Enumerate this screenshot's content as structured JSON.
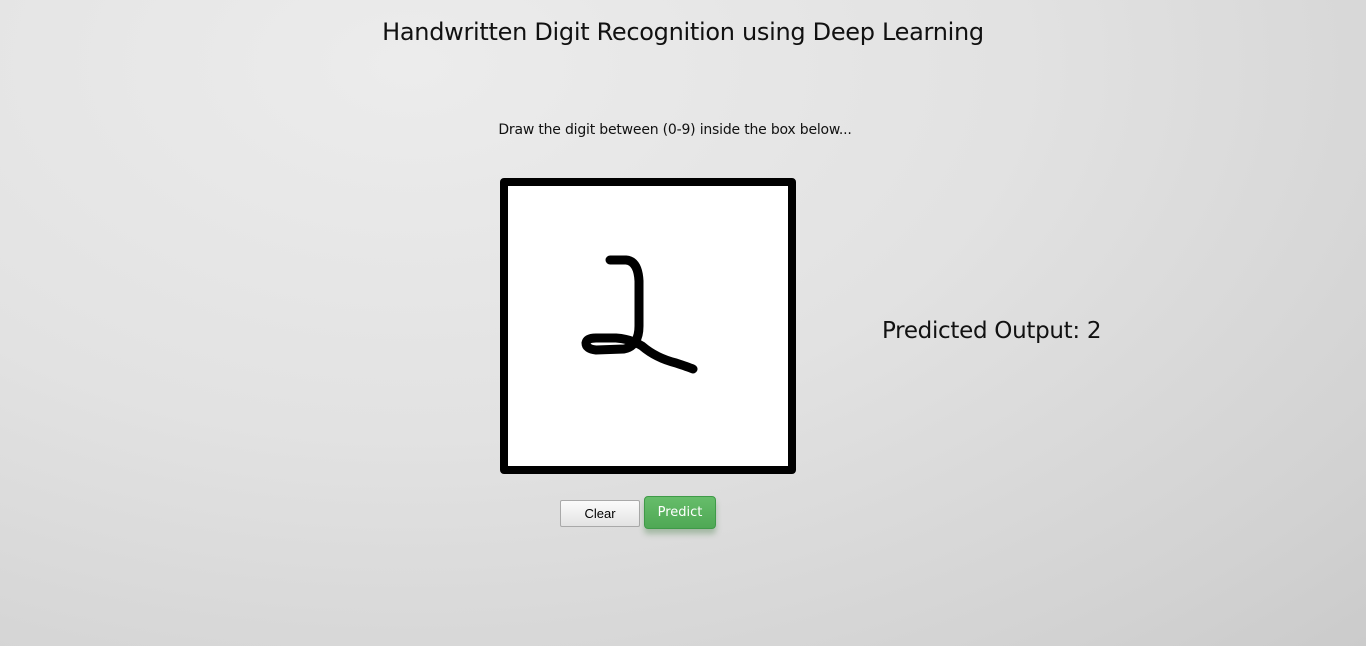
{
  "header": {
    "title": "Handwritten Digit Recognition using Deep Learning"
  },
  "instructions": {
    "text": "Draw the digit between (0-9) inside the box below..."
  },
  "canvas": {
    "background_color": "#ffffff",
    "border_color": "#000000",
    "stroke_color": "#000000"
  },
  "prediction": {
    "label": "Predicted Output: 2"
  },
  "buttons": {
    "clear_label": "Clear",
    "predict_label": "Predict",
    "predict_color": "#5cb85c"
  }
}
